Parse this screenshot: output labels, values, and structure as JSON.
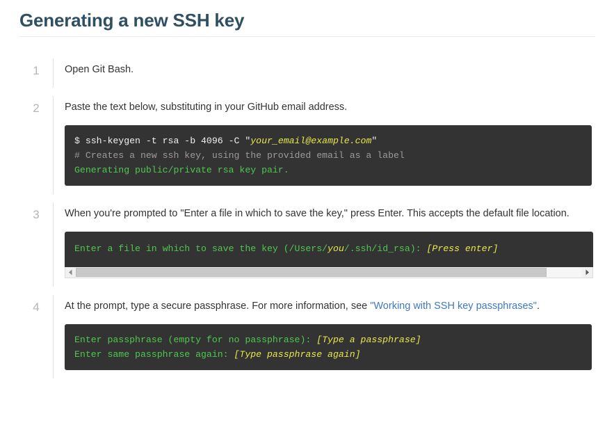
{
  "header": {
    "title": "Generating a new SSH key"
  },
  "steps": [
    {
      "number": "1",
      "text": "Open Git Bash."
    },
    {
      "number": "2",
      "text": "Paste the text below, substituting in your GitHub email address.",
      "code": {
        "lines": [
          [
            {
              "t": "$ ",
              "c": "prompt"
            },
            {
              "t": "ssh-keygen -t rsa -b 4096 -C ",
              "c": "cmd"
            },
            {
              "t": "\"",
              "c": "quote"
            },
            {
              "t": "your_email@example.com",
              "c": "ph"
            },
            {
              "t": "\"",
              "c": "quote"
            }
          ],
          [
            {
              "t": "# Creates a new ssh key, using the provided email as a label",
              "c": "comment"
            }
          ],
          [
            {
              "t": "Generating public/private rsa key pair.",
              "c": "out"
            }
          ]
        ]
      }
    },
    {
      "number": "3",
      "text": "When you're prompted to \"Enter a file in which to save the key,\" press Enter. This accepts the default file location.",
      "code": {
        "scrollable": true,
        "lines": [
          [
            {
              "t": "Enter a file in which to save the key (/Users/",
              "c": "green"
            },
            {
              "t": "you",
              "c": "ph"
            },
            {
              "t": "/.ssh/id_rsa): ",
              "c": "green"
            },
            {
              "t": "[Press enter]",
              "c": "ph"
            }
          ]
        ]
      },
      "scrollbar": {
        "left_arrow": "scroll-left-arrow-icon",
        "right_arrow": "scroll-right-arrow-icon",
        "thumb_width_pct": 93
      }
    },
    {
      "number": "4",
      "text_before": "At the prompt, type a secure passphrase. For more information, see ",
      "link_text": "\"Working with SSH key passphrases\"",
      "text_after": ".",
      "code": {
        "lines": [
          [
            {
              "t": "Enter passphrase (empty for no passphrase): ",
              "c": "green"
            },
            {
              "t": "[Type a passphrase]",
              "c": "ph"
            }
          ],
          [
            {
              "t": "Enter same passphrase again: ",
              "c": "green"
            },
            {
              "t": "[Type passphrase again]",
              "c": "ph"
            }
          ]
        ]
      }
    }
  ],
  "colors": {
    "title": "#2f4f62",
    "link": "#4078c0",
    "code_bg": "#333333",
    "code_output_green": "#4ec94e",
    "code_placeholder_yellow": "#e8e84a",
    "code_comment_gray": "#9b9b9b",
    "step_number": "#b5b5b5",
    "rule": "#e8ebed"
  }
}
